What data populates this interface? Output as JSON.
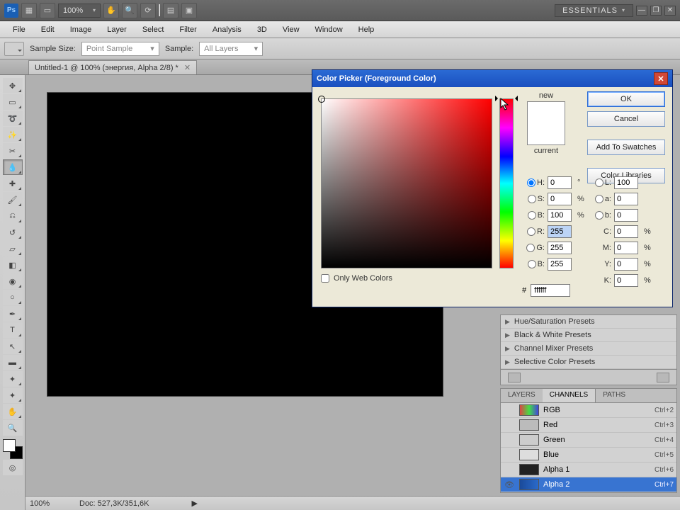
{
  "topbar": {
    "zoom": "100%",
    "workspace": "ESSENTIALS"
  },
  "menu": [
    "File",
    "Edit",
    "Image",
    "Layer",
    "Select",
    "Filter",
    "Analysis",
    "3D",
    "View",
    "Window",
    "Help"
  ],
  "options": {
    "sample_size_label": "Sample Size:",
    "sample_size_value": "Point Sample",
    "sample_label": "Sample:",
    "sample_value": "All Layers"
  },
  "document": {
    "tab_title": "Untitled-1 @ 100% (энергия, Alpha 2/8) *"
  },
  "dialog": {
    "title": "Color Picker (Foreground Color)",
    "new_label": "new",
    "current_label": "current",
    "ok": "OK",
    "cancel": "Cancel",
    "add_swatches": "Add To Swatches",
    "color_libraries": "Color Libraries",
    "only_web": "Only Web Colors",
    "H": "0",
    "S": "0",
    "B": "100",
    "R": "255",
    "G": "255",
    "Bl": "255",
    "L": "100",
    "a": "0",
    "b": "0",
    "C": "0",
    "M": "0",
    "Y": "0",
    "K": "0",
    "hex": "ffffff"
  },
  "presets": [
    "Hue/Saturation Presets",
    "Black & White Presets",
    "Channel Mixer Presets",
    "Selective Color Presets"
  ],
  "channels_panel": {
    "tabs": [
      "LAYERS",
      "CHANNELS",
      "PATHS"
    ],
    "active_tab": 1,
    "rows": [
      {
        "name": "RGB",
        "shortcut": "Ctrl+2",
        "thumb": "rgb"
      },
      {
        "name": "Red",
        "shortcut": "Ctrl+3",
        "thumb": "red"
      },
      {
        "name": "Green",
        "shortcut": "Ctrl+4",
        "thumb": "green"
      },
      {
        "name": "Blue",
        "shortcut": "Ctrl+5",
        "thumb": "blue"
      },
      {
        "name": "Alpha 1",
        "shortcut": "Ctrl+6",
        "thumb": "a1"
      },
      {
        "name": "Alpha 2",
        "shortcut": "Ctrl+7",
        "thumb": "a2",
        "selected": true,
        "visible": true
      }
    ]
  },
  "status": {
    "zoom": "100%",
    "doc": "Doc: 527,3K/351,6K"
  }
}
